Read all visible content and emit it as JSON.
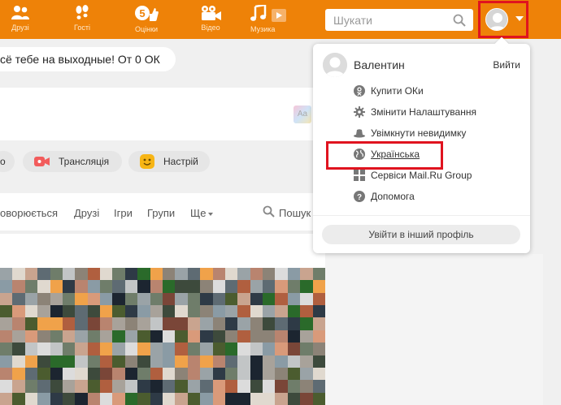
{
  "colors": {
    "accent": "#ee8208",
    "highlight": "#e0131f"
  },
  "nav": {
    "items": [
      {
        "label": "Друзі",
        "icon": "friends-icon"
      },
      {
        "label": "Гості",
        "icon": "footprints-icon"
      },
      {
        "label": "Оцінки",
        "icon": "thumbs-up-icon",
        "badge": "5"
      },
      {
        "label": "Відео",
        "icon": "video-camera-icon"
      },
      {
        "label": "Музика",
        "icon": "music-note-icon"
      }
    ],
    "search_placeholder": "Шукати"
  },
  "banner": {
    "text": "сё тебе на выходные! От 0 ОК"
  },
  "postbox": {
    "font_button": "Aa"
  },
  "actions": {
    "broadcast": "Трансляція",
    "mood": "Настрій",
    "partial": "о"
  },
  "feed_tabs": {
    "partial": "оворюється",
    "friends": "Друзі",
    "games": "Ігри",
    "groups": "Групи",
    "more": "Ще",
    "search": "Пошук"
  },
  "user_menu": {
    "name": "Валентин",
    "logout": "Вийти",
    "items": [
      {
        "label": "Купити ОКи",
        "icon": "ok-coin-icon"
      },
      {
        "label": "Змінити Налаштування",
        "icon": "gear-icon"
      },
      {
        "label": "Увімкнути невидимку",
        "icon": "hat-icon"
      },
      {
        "label": "Українська",
        "icon": "globe-icon"
      },
      {
        "label": "Сервіси Mail.Ru Group",
        "icon": "grid-icon"
      },
      {
        "label": "Допомога",
        "icon": "help-icon"
      }
    ],
    "switch_profile": "Увійти в інший профіль"
  }
}
